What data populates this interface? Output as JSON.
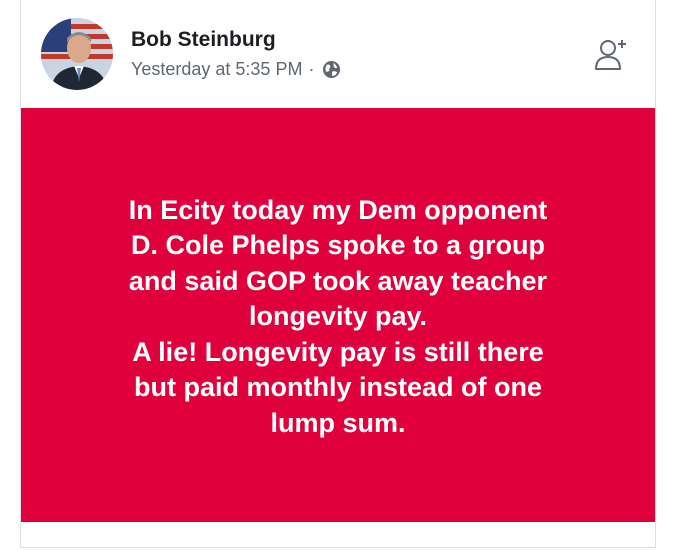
{
  "post": {
    "author": {
      "name": "Bob Steinburg",
      "avatar_icon": "profile-photo"
    },
    "timestamp": "Yesterday at 5:35 PM",
    "separator": "·",
    "privacy_icon": "globe-icon",
    "action_icon": "add-friend-icon",
    "background_color": "#e0003c",
    "text": "In Ecity today my Dem opponent\nD. Cole Phelps spoke to a group\nand said GOP took away teacher\nlongevity pay.\nA lie! Longevity pay is still there\nbut paid monthly instead of one\nlump sum."
  }
}
